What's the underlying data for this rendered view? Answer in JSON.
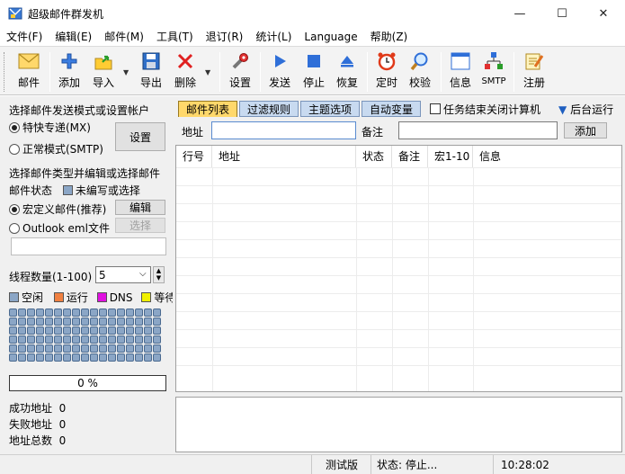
{
  "window": {
    "title": "超级邮件群发机",
    "controls": {
      "minimize": "—",
      "maximize": "☐",
      "close": "✕"
    }
  },
  "menu": [
    "文件(F)",
    "编辑(E)",
    "邮件(M)",
    "工具(T)",
    "退订(R)",
    "统计(L)",
    "Language",
    "帮助(Z)"
  ],
  "toolbar": {
    "mail": "邮件",
    "add": "添加",
    "import": "导入",
    "export": "导出",
    "delete": "删除",
    "settings": "设置",
    "send": "发送",
    "stop": "停止",
    "resume": "恢复",
    "timer": "定时",
    "verify": "校验",
    "info": "信息",
    "smtp": "SMTP",
    "register": "注册",
    "dropdown_arrow": "▼"
  },
  "left": {
    "mode_heading": "选择邮件发送模式或设置帐户",
    "mode_express": "特快专递(MX)",
    "mode_normal": "正常模式(SMTP)",
    "settings_button": "设置",
    "type_heading": "选择邮件类型并编辑或选择邮件",
    "status_label": "邮件状态",
    "status_value": "未编写或选择",
    "macro_mail": "宏定义邮件(推荐)",
    "edit_button": "编辑",
    "outlook_eml": "Outlook eml文件",
    "select_button": "选择",
    "eml_path": "",
    "thread_label": "线程数量(1-100)",
    "thread_value": "5",
    "legend": [
      {
        "label": "空闲",
        "color": "#8ba6c6"
      },
      {
        "label": "运行",
        "color": "#f08040"
      },
      {
        "label": "DNS",
        "color": "#e010e0"
      },
      {
        "label": "等待",
        "color": "#f0f000"
      }
    ],
    "progress_percent": 0,
    "progress_text": "0 %",
    "success_label": "成功地址",
    "success_value": "0",
    "failed_label": "失败地址",
    "failed_value": "0",
    "total_label": "地址总数",
    "total_value": "0"
  },
  "right": {
    "tabs": [
      "邮件列表",
      "过滤规则",
      "主题选项",
      "自动变量"
    ],
    "active_tab": 0,
    "shutdown_label": "任务结束关闭计算机",
    "shutdown_checked": false,
    "background_run": "后台运行",
    "addr_label": "地址",
    "addr_value": "",
    "note_label": "备注",
    "note_value": "",
    "add_button": "添加",
    "columns": [
      "行号",
      "地址",
      "状态",
      "备注",
      "宏1-10",
      "信息"
    ]
  },
  "status": {
    "edition": "测试版",
    "state": "状态: 停止...",
    "time": "10:28:02"
  }
}
